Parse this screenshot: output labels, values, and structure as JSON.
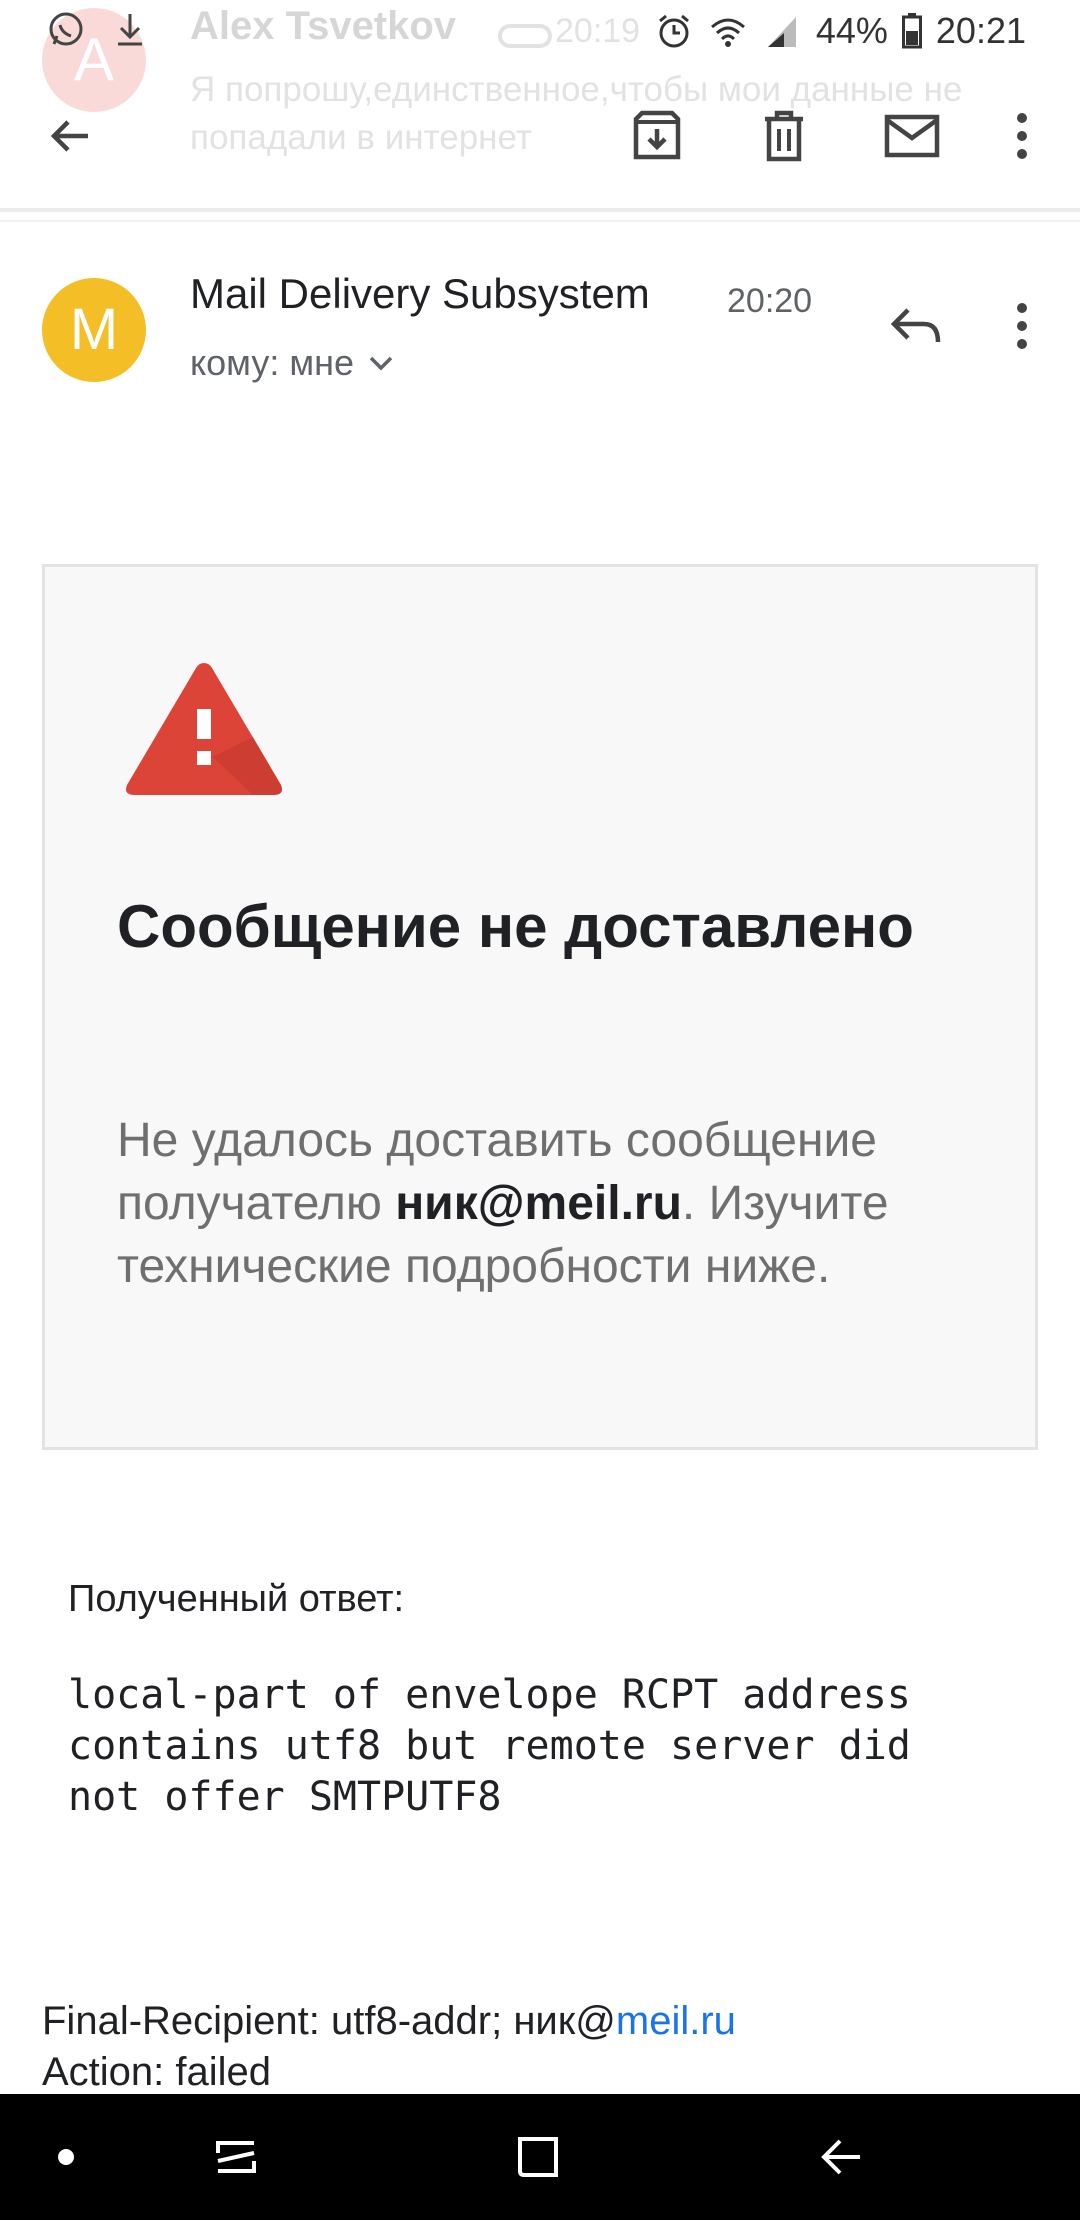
{
  "status_bar": {
    "battery": "44%",
    "time": "20:21"
  },
  "previous_message": {
    "avatar_letter": "A",
    "sender": "Alex Tsvetkov",
    "time": "20:19",
    "snippet": "Я попрошу,единственное,чтобы мои данные не попадали в интернет"
  },
  "toolbar": {
    "icons": [
      "back-arrow-icon",
      "archive-icon",
      "delete-icon",
      "mark-unread-icon",
      "more-vert-icon"
    ]
  },
  "message": {
    "avatar_letter": "M",
    "sender": "Mail Delivery Subsystem",
    "time": "20:20",
    "recipient": "кому: мне"
  },
  "failure_card": {
    "title": "Сообщение не доставлено",
    "body_prefix": "Не удалось доставить сообщение получателю ",
    "address": "ник@meil.ru",
    "body_suffix": ". Изучите технические подробности ниже."
  },
  "response": {
    "label": "Полученный ответ:",
    "text": "local-part of envelope RCPT address\ncontains utf8 but remote server did\nnot offer SMTPUTF8"
  },
  "details": {
    "final_recipient_prefix": "Final-Recipient: utf8-addr; ник@",
    "final_recipient_link": "meil.ru",
    "action": "Action: failed"
  },
  "colors": {
    "avatar_m": "#f4bf26",
    "warning_red": "#db4437",
    "link_blue": "#1a73e8"
  }
}
